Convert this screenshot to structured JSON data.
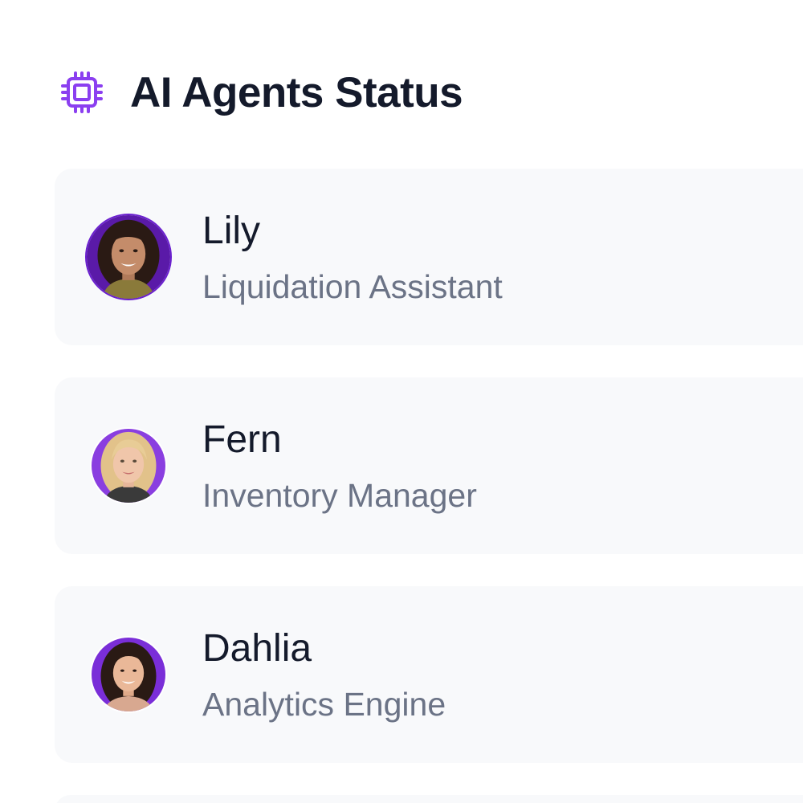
{
  "header": {
    "title": "AI Agents Status",
    "icon": "cpu-chip-icon",
    "accent_color": "#8b3ff0"
  },
  "agents": [
    {
      "name": "Lily",
      "role": "Liquidation Assistant",
      "avatar": "avatar-portrait"
    },
    {
      "name": "Fern",
      "role": "Inventory Manager",
      "avatar": "avatar-portrait"
    },
    {
      "name": "Dahlia",
      "role": "Analytics Engine",
      "avatar": "avatar-portrait"
    }
  ],
  "colors": {
    "card_background": "#f8f9fb",
    "name_text": "#141a2b",
    "role_text": "#6b7386",
    "avatar_ring": "#7c2ee6"
  }
}
